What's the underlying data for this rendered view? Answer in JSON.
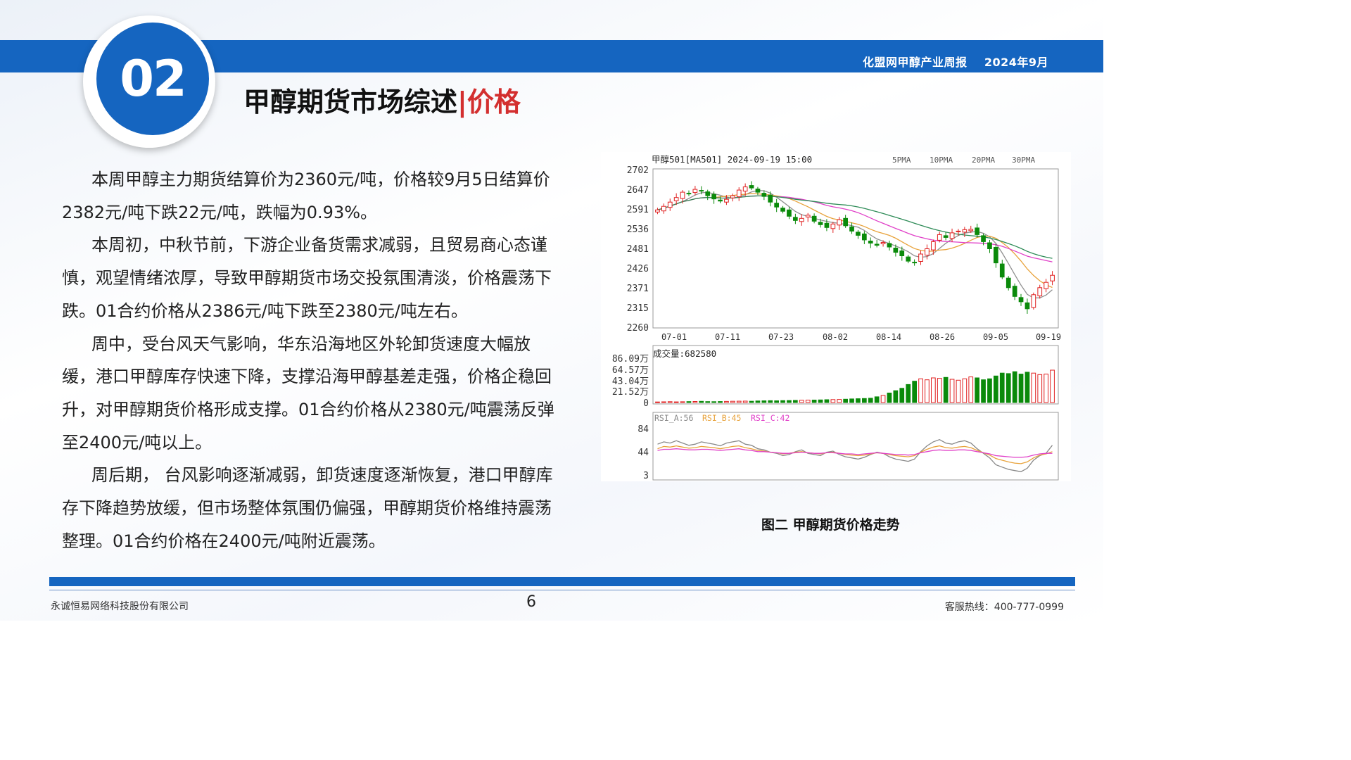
{
  "header": {
    "report": "化盟网甲醇产业周报",
    "date": "2024年9月"
  },
  "section": {
    "number": "02",
    "title_main": "甲醇期货市场综述",
    "title_sep": "|",
    "title_sub": "价格"
  },
  "paragraphs": [
    "本周甲醇主力期货结算价为2360元/吨，价格较9月5日结算价2382元/吨下跌22元/吨，跌幅为0.93%。",
    "本周初，中秋节前，下游企业备货需求减弱，且贸易商心态谨慎，观望情绪浓厚，导致甲醇期货市场交投氛围清淡，价格震荡下跌。01合约价格从2386元/吨下跌至2380元/吨左右。",
    "周中，受台风天气影响，华东沿海地区外轮卸货速度大幅放缓，港口甲醇库存快速下降，支撑沿海甲醇基差走强，价格企稳回升，对甲醇期货价格形成支撑。01合约价格从2380元/吨震荡反弹至2400元/吨以上。",
    "周后期， 台风影响逐渐减弱，卸货速度逐渐恢复，港口甲醇库存下降趋势放缓，但市场整体氛围仍偏强，甲醇期货价格维持震荡整理。01合约价格在2400元/吨附近震荡。"
  ],
  "chart_caption": "图二  甲醇期货价格走势",
  "chart_data": {
    "type": "candlestick",
    "title": "甲醇501[MA501] 2024-09-19 15:00",
    "legend": [
      {
        "name": "5PMA",
        "color": "#888888"
      },
      {
        "name": "10PMA",
        "color": "#888888"
      },
      {
        "name": "20PMA",
        "color": "#e8a23a"
      },
      {
        "name": "30PMA",
        "color": "#e040c8"
      }
    ],
    "ma_colors": {
      "ma5": "#909090",
      "ma10": "#e8a23a",
      "ma20": "#e040c8",
      "ma30": "#2e8b57"
    },
    "price_axis": {
      "ticks": [
        "2702",
        "2647",
        "2591",
        "2536",
        "2481",
        "2426",
        "2371",
        "2315",
        "2260"
      ],
      "ylim": [
        2260,
        2702
      ]
    },
    "date_labels": [
      "07-01",
      "07-11",
      "07-23",
      "08-02",
      "08-14",
      "08-26",
      "09-05",
      "09-19"
    ],
    "closes": [
      2590,
      2600,
      2612,
      2625,
      2640,
      2635,
      2648,
      2644,
      2630,
      2621,
      2615,
      2620,
      2630,
      2646,
      2655,
      2652,
      2640,
      2628,
      2612,
      2598,
      2586,
      2572,
      2560,
      2566,
      2575,
      2558,
      2548,
      2540,
      2550,
      2562,
      2545,
      2530,
      2518,
      2505,
      2496,
      2490,
      2498,
      2485,
      2470,
      2460,
      2445,
      2440,
      2465,
      2480,
      2500,
      2520,
      2512,
      2525,
      2530,
      2534,
      2535,
      2520,
      2500,
      2480,
      2440,
      2400,
      2370,
      2345,
      2330,
      2310,
      2350,
      2370,
      2385,
      2405
    ],
    "volume": {
      "label": "成交量:682580",
      "ticks": [
        "86.09万",
        "64.57万",
        "43.04万",
        "21.52万",
        "0"
      ],
      "max": 860900,
      "values": [
        12000,
        15000,
        18000,
        14000,
        16000,
        19000,
        22000,
        25000,
        20000,
        18000,
        21000,
        24000,
        26000,
        28000,
        30000,
        27000,
        32000,
        35000,
        38000,
        36000,
        40000,
        42000,
        45000,
        48000,
        50000,
        52000,
        55000,
        60000,
        62000,
        65000,
        70000,
        75000,
        80000,
        85000,
        90000,
        120000,
        150000,
        200000,
        250000,
        300000,
        380000,
        450000,
        500000,
        480000,
        520000,
        510000,
        530000,
        490000,
        470000,
        500000,
        540000,
        520000,
        480000,
        500000,
        560000,
        620000,
        610000,
        650000,
        600000,
        640000,
        620000,
        590000,
        600000,
        682580
      ]
    },
    "rsi": {
      "label_a": "RSI_A:56",
      "label_b": "RSI_B:45",
      "label_c": "RSI_C:42",
      "colors": {
        "a": "#888888",
        "b": "#e8a23a",
        "c": "#e040c8"
      },
      "ticks": [
        "84",
        "44",
        "3"
      ],
      "ylim": [
        3,
        84
      ],
      "a": [
        58,
        62,
        60,
        64,
        60,
        56,
        58,
        62,
        60,
        58,
        55,
        60,
        62,
        64,
        58,
        56,
        50,
        48,
        44,
        42,
        38,
        40,
        45,
        48,
        42,
        40,
        38,
        44,
        46,
        40,
        36,
        34,
        32,
        35,
        40,
        44,
        42,
        36,
        32,
        30,
        28,
        32,
        45,
        55,
        62,
        66,
        60,
        58,
        62,
        64,
        60,
        50,
        42,
        34,
        22,
        18,
        14,
        12,
        10,
        16,
        30,
        38,
        42,
        56
      ],
      "b": [
        50,
        54,
        53,
        55,
        53,
        51,
        52,
        54,
        53,
        52,
        50,
        52,
        54,
        55,
        52,
        50,
        47,
        46,
        44,
        43,
        41,
        42,
        44,
        45,
        43,
        42,
        41,
        43,
        44,
        42,
        40,
        39,
        38,
        39,
        41,
        43,
        42,
        40,
        38,
        37,
        36,
        38,
        44,
        49,
        53,
        55,
        52,
        51,
        53,
        54,
        52,
        47,
        43,
        39,
        33,
        30,
        27,
        25,
        24,
        27,
        34,
        39,
        41,
        45
      ],
      "c": [
        47,
        49,
        49,
        50,
        49,
        48,
        48,
        49,
        49,
        48,
        47,
        48,
        49,
        50,
        48,
        47,
        45,
        45,
        44,
        43,
        42,
        42,
        43,
        44,
        43,
        42,
        42,
        43,
        43,
        42,
        41,
        41,
        40,
        41,
        42,
        43,
        42,
        41,
        40,
        40,
        39,
        40,
        43,
        45,
        47,
        48,
        47,
        47,
        48,
        48,
        47,
        45,
        43,
        41,
        38,
        37,
        36,
        35,
        35,
        36,
        39,
        41,
        42,
        42
      ]
    }
  },
  "footer": {
    "company": "永诚恒易网络科技股份有限公司",
    "page": "6",
    "hotline": "客服热线：400-777-0999"
  }
}
